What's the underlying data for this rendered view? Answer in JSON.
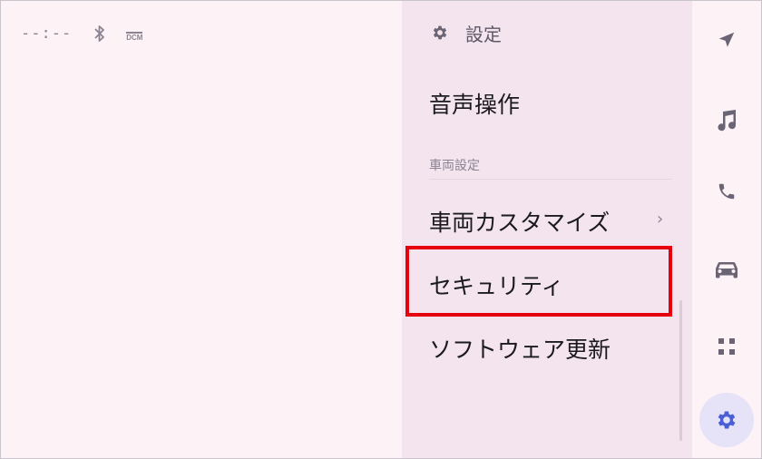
{
  "status": {
    "clock": "--:--",
    "dcm_label": "DCM"
  },
  "settings": {
    "title": "設定",
    "voice_item": "音声操作",
    "section_vehicle": "車両設定",
    "vehicle_customize": "車両カスタマイズ",
    "chevron": "›",
    "security": "セキュリティ",
    "software_update": "ソフトウェア更新"
  },
  "rail": {
    "icons": [
      "navigation-icon",
      "music-icon",
      "phone-icon",
      "car-icon",
      "apps-grid-icon",
      "settings-gear-icon"
    ],
    "active": "settings-gear-icon"
  },
  "colors": {
    "highlight": "#e6000f",
    "accent": "#4a5fd6",
    "icon": "#6b6475"
  }
}
